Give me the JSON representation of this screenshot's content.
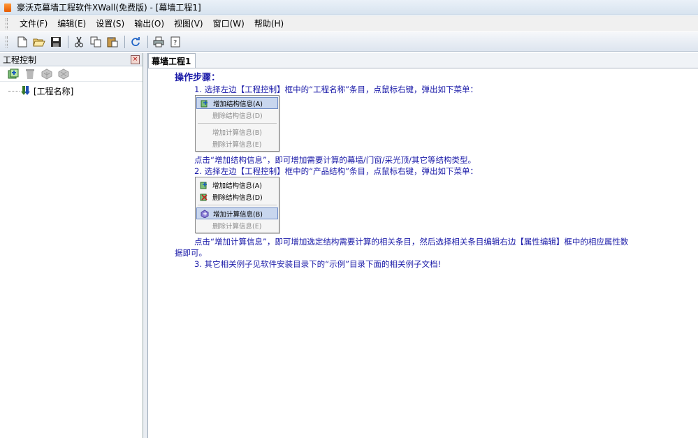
{
  "window": {
    "title": "豪沃克幕墙工程软件XWall(免费版)  - [幕墙工程1]"
  },
  "menubar": [
    "文件(F)",
    "编辑(E)",
    "设置(S)",
    "输出(O)",
    "视图(V)",
    "窗口(W)",
    "帮助(H)"
  ],
  "toolbar": {
    "buttons": [
      "new-icon",
      "open-icon",
      "save-icon",
      "cut-icon",
      "copy-icon",
      "paste-icon",
      "refresh-icon",
      "print-icon",
      "help-icon"
    ]
  },
  "left_panel": {
    "title": "工程控制",
    "close_glyph": "×",
    "tree": {
      "root_label": "[工程名称]"
    }
  },
  "editor": {
    "tab_label": "幕墙工程1",
    "heading": "操作步骤：",
    "step1": "1.   选择左边【工程控制】框中的“工程名称”条目，点鼠标右键，弹出如下菜单：",
    "menu1": [
      {
        "label": "增加结构信息(A)",
        "state": "active",
        "icon": "add-structure-icon"
      },
      {
        "label": "删除结构信息(D)",
        "state": "disabled",
        "icon": ""
      },
      {
        "sep": true
      },
      {
        "label": "增加计算信息(B)",
        "state": "disabled",
        "icon": ""
      },
      {
        "label": "删除计算信息(E)",
        "state": "disabled",
        "icon": ""
      }
    ],
    "note1": "点击“增加结构信息”，即可增加需要计算的幕墙/门窗/采光顶/其它等结构类型。",
    "step2": "2.   选择左边【工程控制】框中的“产品结构”条目，点鼠标右键，弹出如下菜单：",
    "menu2": [
      {
        "label": "增加结构信息(A)",
        "state": "normal",
        "icon": "add-structure-icon"
      },
      {
        "label": "删除结构信息(D)",
        "state": "normal",
        "icon": "delete-structure-icon"
      },
      {
        "sep": true
      },
      {
        "label": "增加计算信息(B)",
        "state": "active",
        "icon": "add-calc-icon"
      },
      {
        "label": "删除计算信息(E)",
        "state": "disabled",
        "icon": ""
      }
    ],
    "note2_line1": "点击“增加计算信息”，即可增加选定结构需要计算的相关条目，然后选择相关条目编辑右边【属性编辑】框中的相应属性数",
    "note2_line2": "据即可。",
    "step3": "3.      其它相关例子见软件安装目录下的“示例”目录下面的相关例子文档!"
  }
}
